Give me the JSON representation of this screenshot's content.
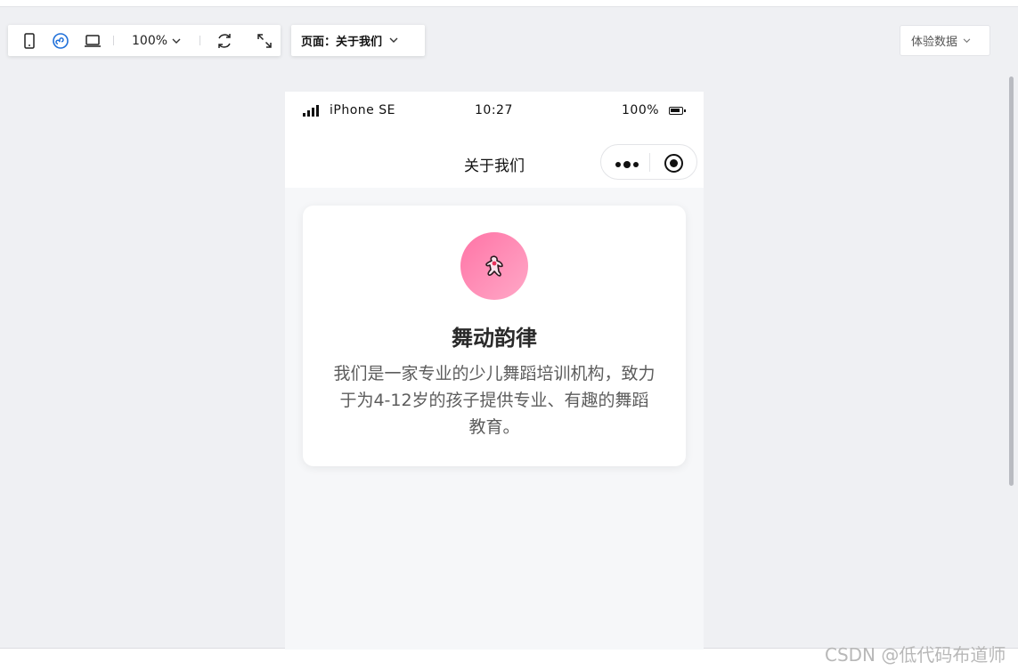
{
  "toolbar": {
    "zoom": "100%",
    "page_select": "页面：关于我们",
    "experience_data": "体验数据"
  },
  "phone": {
    "carrier": "iPhone SE",
    "time": "10:27",
    "battery": "100%",
    "nav_title": "关于我们"
  },
  "card": {
    "title": "舞动韵律",
    "description": "我们是一家专业的少儿舞蹈培训机构，致力于为4-12岁的孩子提供专业、有趣的舞蹈教育。"
  },
  "watermark": "CSDN @低代码布道师",
  "colors": {
    "accent": "#1e6fd9",
    "logo_start": "#ff74a6",
    "logo_end": "#ffa8c7"
  }
}
